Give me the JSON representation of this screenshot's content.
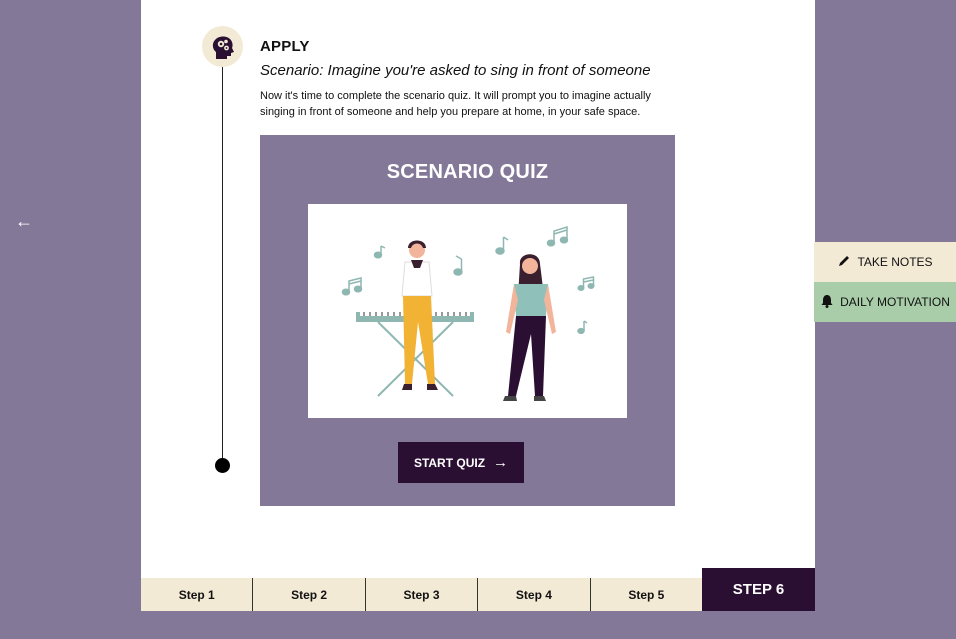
{
  "nav": {
    "back_icon": "arrow-left-icon"
  },
  "lesson": {
    "section_title": "APPLY",
    "scenario": "Scenario: Imagine you're asked to sing in front of someone",
    "description": "Now it's time to complete the scenario quiz. It will prompt you to imagine actually singing in front of someone and help you prepare at home, in your safe space."
  },
  "quiz": {
    "title": "SCENARIO QUIZ",
    "start_label": "START QUIZ"
  },
  "side_buttons": {
    "take_notes": "TAKE NOTES",
    "daily_motivation": "DAILY MOTIVATION"
  },
  "steps": [
    "Step 1",
    "Step 2",
    "Step 3",
    "Step 4",
    "Step 5"
  ],
  "active_step": "STEP 6",
  "colors": {
    "background": "#847898",
    "dark_purple": "#2b0f33",
    "cream": "#f3ead6",
    "mint": "#a9cda9",
    "teal": "#8fb7b1"
  }
}
